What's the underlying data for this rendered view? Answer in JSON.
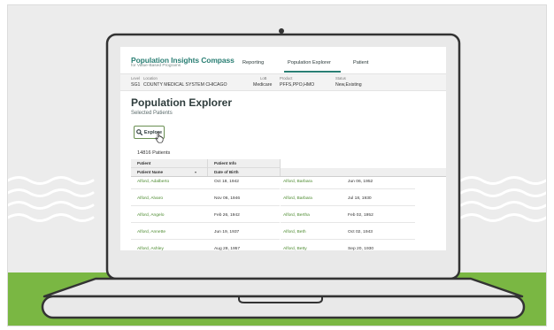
{
  "app": {
    "title": "Population Insights Compass",
    "subtitle": "for Value-Based Programs"
  },
  "nav": {
    "links": [
      "Reporting",
      "Population Explorer",
      "Patient"
    ],
    "active": "Population Explorer"
  },
  "info_bar": {
    "level_label": "Level",
    "level_value": "SG1",
    "location_label": "Location",
    "location_value": "COUNTY MEDICAL SYSTEM CHICAGO",
    "lob_label": "LoB",
    "lob_value": "Medicare",
    "product_label": "Product",
    "product_value": "PFFS,PPO,HMO",
    "status_label": "Status",
    "status_value": "New,Existing"
  },
  "page": {
    "title": "Population Explorer",
    "subtitle": "Selected Patients",
    "explore_label": "Explore",
    "patient_count": "14816 Patients"
  },
  "table": {
    "group_headers": [
      "Patient",
      "Patient Info"
    ],
    "columns": [
      "Patient Name",
      "Date of Birth"
    ],
    "left_rows": [
      {
        "name": "Alford, Adalberto",
        "dob": "Oct 18, 1942"
      },
      {
        "name": "Alford, Alvaro",
        "dob": "Nov 06, 1946"
      },
      {
        "name": "Alford, Angelo",
        "dob": "Feb 26, 1942"
      },
      {
        "name": "Alford, Annette",
        "dob": "Jun 19, 1937"
      },
      {
        "name": "Alford, Ashley",
        "dob": "Aug 28, 1957"
      }
    ],
    "right_rows": [
      {
        "name": "Alford, Barbara",
        "dob": "Jun 06, 1952"
      },
      {
        "name": "Alford, Barbara",
        "dob": "Jul 18, 1930"
      },
      {
        "name": "Alford, Bertha",
        "dob": "Feb 02, 1952"
      },
      {
        "name": "Alford, Beth",
        "dob": "Oct 02, 1943"
      },
      {
        "name": "Alford, Betty",
        "dob": "Sep 20, 1930"
      }
    ]
  },
  "icons": {
    "search": "search-icon",
    "cursor": "hand-cursor-icon",
    "camera": "camera-icon"
  },
  "colors": {
    "brand": "#2a7f74",
    "patient_link": "#4b8a2e",
    "explore_border": "#6a8f52",
    "grass": "#7ab743",
    "laptop_body": "#e9e9e9",
    "laptop_outline": "#333333"
  }
}
